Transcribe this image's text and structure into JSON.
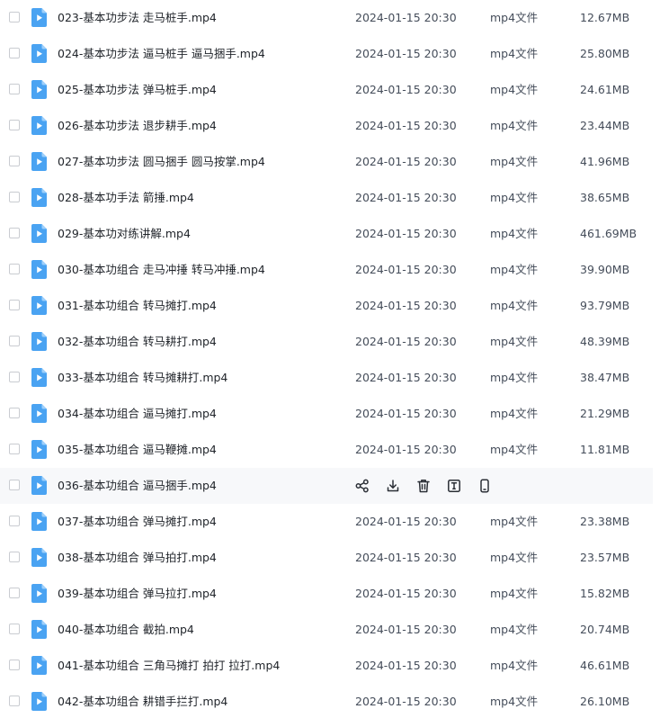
{
  "files": [
    {
      "name": "023-基本功步法 走马桩手.mp4",
      "date": "2024-01-15 20:30",
      "type": "mp4文件",
      "size": "12.67MB"
    },
    {
      "name": "024-基本功步法 逼马桩手 逼马捆手.mp4",
      "date": "2024-01-15 20:30",
      "type": "mp4文件",
      "size": "25.80MB"
    },
    {
      "name": "025-基本功步法 弹马桩手.mp4",
      "date": "2024-01-15 20:30",
      "type": "mp4文件",
      "size": "24.61MB"
    },
    {
      "name": "026-基本功步法 退步耕手.mp4",
      "date": "2024-01-15 20:30",
      "type": "mp4文件",
      "size": "23.44MB"
    },
    {
      "name": "027-基本功步法 圆马捆手 圆马按掌.mp4",
      "date": "2024-01-15 20:30",
      "type": "mp4文件",
      "size": "41.96MB"
    },
    {
      "name": "028-基本功手法 箭捶.mp4",
      "date": "2024-01-15 20:30",
      "type": "mp4文件",
      "size": "38.65MB"
    },
    {
      "name": "029-基本功对练讲解.mp4",
      "date": "2024-01-15 20:30",
      "type": "mp4文件",
      "size": "461.69MB"
    },
    {
      "name": "030-基本功组合 走马冲捶 转马冲捶.mp4",
      "date": "2024-01-15 20:30",
      "type": "mp4文件",
      "size": "39.90MB"
    },
    {
      "name": "031-基本功组合 转马摊打.mp4",
      "date": "2024-01-15 20:30",
      "type": "mp4文件",
      "size": "93.79MB"
    },
    {
      "name": "032-基本功组合 转马耕打.mp4",
      "date": "2024-01-15 20:30",
      "type": "mp4文件",
      "size": "48.39MB"
    },
    {
      "name": "033-基本功组合 转马摊耕打.mp4",
      "date": "2024-01-15 20:30",
      "type": "mp4文件",
      "size": "38.47MB"
    },
    {
      "name": "034-基本功组合 逼马摊打.mp4",
      "date": "2024-01-15 20:30",
      "type": "mp4文件",
      "size": "21.29MB"
    },
    {
      "name": "035-基本功组合 逼马鞭摊.mp4",
      "date": "2024-01-15 20:30",
      "type": "mp4文件",
      "size": "11.81MB"
    },
    {
      "name": "036-基本功组合 逼马捆手.mp4",
      "hovered": true
    },
    {
      "name": "037-基本功组合 弹马摊打.mp4",
      "date": "2024-01-15 20:30",
      "type": "mp4文件",
      "size": "23.38MB"
    },
    {
      "name": "038-基本功组合 弹马拍打.mp4",
      "date": "2024-01-15 20:30",
      "type": "mp4文件",
      "size": "23.57MB"
    },
    {
      "name": "039-基本功组合 弹马拉打.mp4",
      "date": "2024-01-15 20:30",
      "type": "mp4文件",
      "size": "15.82MB"
    },
    {
      "name": "040-基本功组合 截拍.mp4",
      "date": "2024-01-15 20:30",
      "type": "mp4文件",
      "size": "20.74MB"
    },
    {
      "name": "041-基本功组合 三角马摊打 拍打 拉打.mp4",
      "date": "2024-01-15 20:30",
      "type": "mp4文件",
      "size": "46.61MB"
    },
    {
      "name": "042-基本功组合 耕错手拦打.mp4",
      "date": "2024-01-15 20:30",
      "type": "mp4文件",
      "size": "26.10MB"
    }
  ],
  "row_actions": [
    "share-icon",
    "download-icon",
    "delete-icon",
    "rename-icon",
    "phone-icon"
  ],
  "colors": {
    "file_icon": "#4aa3f2",
    "action_icon": "#2b2f36",
    "hover_row": "#f7f8fa"
  }
}
